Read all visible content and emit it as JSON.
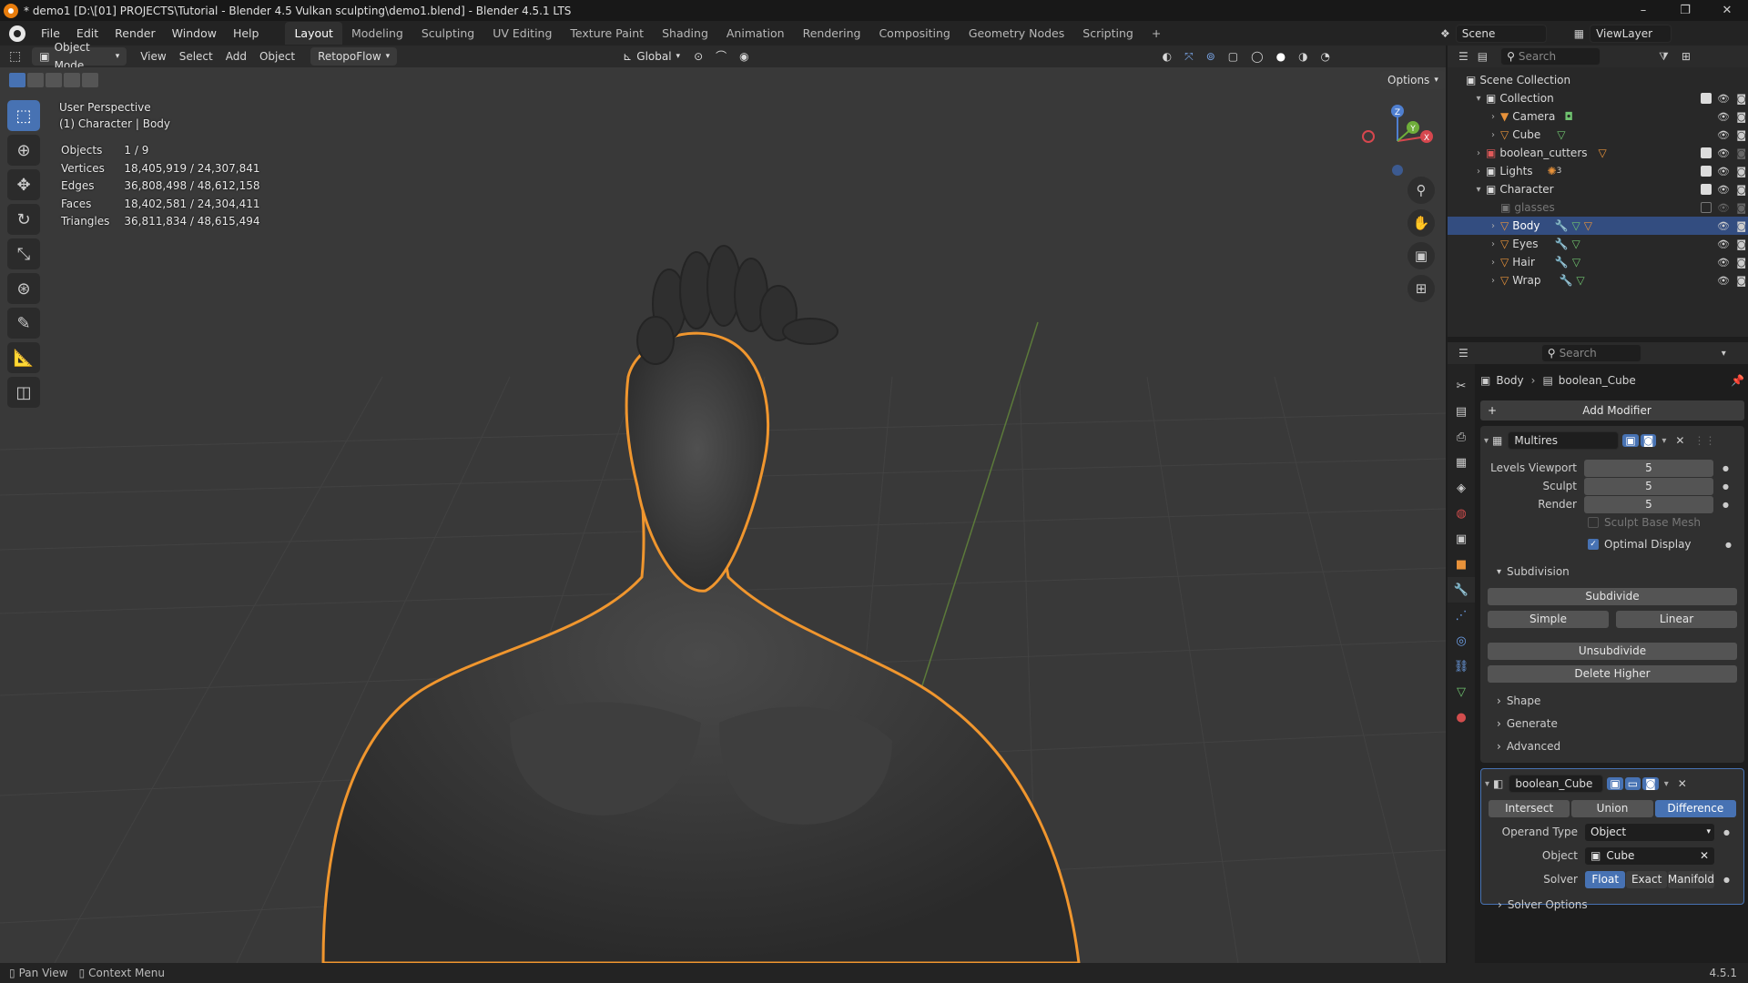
{
  "window": {
    "title": "* demo1 [D:\\[01] PROJECTS\\Tutorial - Blender 4.5 Vulkan sculpting\\demo1.blend] - Blender 4.5.1 LTS",
    "controls": [
      "–",
      "❐",
      "✕"
    ]
  },
  "menu": [
    "File",
    "Edit",
    "Render",
    "Window",
    "Help"
  ],
  "workspaces": [
    "Layout",
    "Modeling",
    "Sculpting",
    "UV Editing",
    "Texture Paint",
    "Shading",
    "Animation",
    "Rendering",
    "Compositing",
    "Geometry Nodes",
    "Scripting",
    "+"
  ],
  "active_workspace": "Layout",
  "scene": {
    "name": "Scene",
    "view_layer": "ViewLayer"
  },
  "viewport_header": {
    "mode": "Object Mode",
    "menus": [
      "View",
      "Select",
      "Add",
      "Object",
      "RetopoFlow"
    ],
    "orientation": "Global",
    "options": "Options"
  },
  "viewport_info": {
    "perspective": "User Perspective",
    "context": "(1) Character | Body",
    "stats": [
      {
        "label": "Objects",
        "value": "1 / 9"
      },
      {
        "label": "Vertices",
        "value": "18,405,919 / 24,307,841"
      },
      {
        "label": "Edges",
        "value": "36,808,498 / 48,612,158"
      },
      {
        "label": "Faces",
        "value": "18,402,581 / 24,304,411"
      },
      {
        "label": "Triangles",
        "value": "36,811,834 / 48,615,494"
      }
    ]
  },
  "gizmo": {
    "x": "X",
    "y": "Y",
    "z": "Z"
  },
  "outliner": {
    "search_placeholder": "Search",
    "root": "Scene Collection",
    "items": [
      {
        "name": "Collection",
        "type": "collection"
      },
      {
        "name": "Camera",
        "type": "camera"
      },
      {
        "name": "Cube",
        "type": "mesh"
      },
      {
        "name": "boolean_cutters",
        "type": "collection"
      },
      {
        "name": "Lights",
        "type": "collection",
        "badge": "3"
      },
      {
        "name": "Character",
        "type": "collection"
      },
      {
        "name": "glasses",
        "type": "collection"
      },
      {
        "name": "Body",
        "type": "mesh"
      },
      {
        "name": "Eyes",
        "type": "mesh"
      },
      {
        "name": "Hair",
        "type": "mesh"
      },
      {
        "name": "Wrap",
        "type": "mesh"
      }
    ]
  },
  "properties": {
    "search_placeholder": "Search",
    "breadcrumb": {
      "object": "Body",
      "modifier": "boolean_Cube"
    },
    "add_modifier": "Add Modifier",
    "multires": {
      "name": "Multires",
      "levels_viewport_label": "Levels Viewport",
      "levels_viewport": "5",
      "sculpt_label": "Sculpt",
      "sculpt": "5",
      "render_label": "Render",
      "render": "5",
      "sculpt_base_mesh": "Sculpt Base Mesh",
      "optimal_display": "Optimal Display",
      "subdivision_label": "Subdivision",
      "subdivide": "Subdivide",
      "simple": "Simple",
      "linear": "Linear",
      "unsubdivide": "Unsubdivide",
      "delete_higher": "Delete Higher",
      "sections": [
        "Shape",
        "Generate",
        "Advanced"
      ]
    },
    "boolean": {
      "name": "boolean_Cube",
      "ops": [
        "Intersect",
        "Union",
        "Difference"
      ],
      "active_op": "Difference",
      "operand_type_label": "Operand Type",
      "operand_type": "Object",
      "object_label": "Object",
      "object": "Cube",
      "solver_label": "Solver",
      "solvers": [
        "Float",
        "Exact",
        "Manifold"
      ],
      "active_solver": "Float",
      "solver_options": "Solver Options"
    }
  },
  "status": {
    "left1": "Pan View",
    "left2": "Context Menu",
    "version": "4.5.1"
  },
  "colors": {
    "accent": "#4772b3",
    "selection_outline": "#f0962e",
    "select_row": "#334d80"
  }
}
